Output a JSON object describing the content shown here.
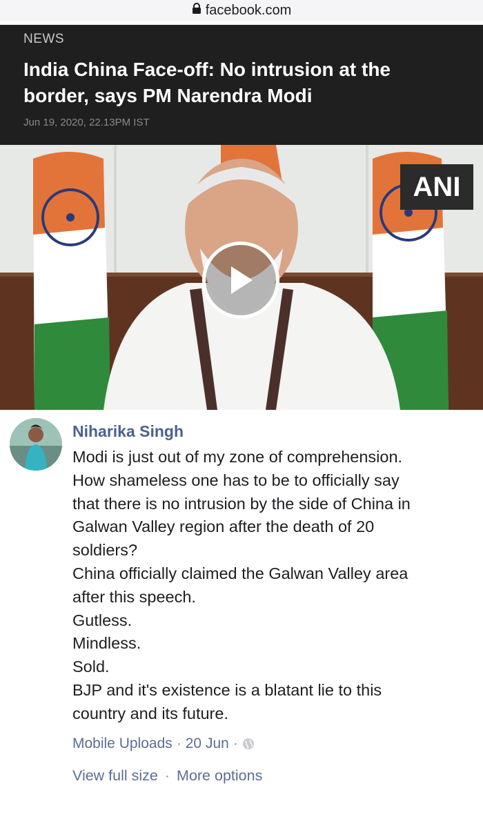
{
  "browser": {
    "url": "facebook.com"
  },
  "news": {
    "kicker": "NEWS",
    "headline_line1": "India China Face-off: No intrusion at the",
    "headline_line2": "border, says PM Narendra Modi",
    "date": "Jun 19, 2020, 22.13PM IST"
  },
  "video": {
    "watermark": "ANI"
  },
  "comment": {
    "author": "Niharika Singh",
    "lines": [
      "Modi is just out of my zone of comprehension.",
      "How shameless one has to be to officially say",
      "that there is no intrusion by the side of China in",
      "Galwan Valley region after the death of 20",
      "soldiers?",
      "China officially claimed the Galwan Valley area",
      "after this speech.",
      "Gutless.",
      "Mindless.",
      "Sold.",
      "BJP and it's existence is a blatant lie to this",
      "country and its future."
    ],
    "album": "Mobile Uploads",
    "sep1": "·",
    "date": "20 Jun",
    "sep2": "·",
    "view_full_size": "View full size",
    "sep3": "·",
    "more_options": "More options"
  }
}
